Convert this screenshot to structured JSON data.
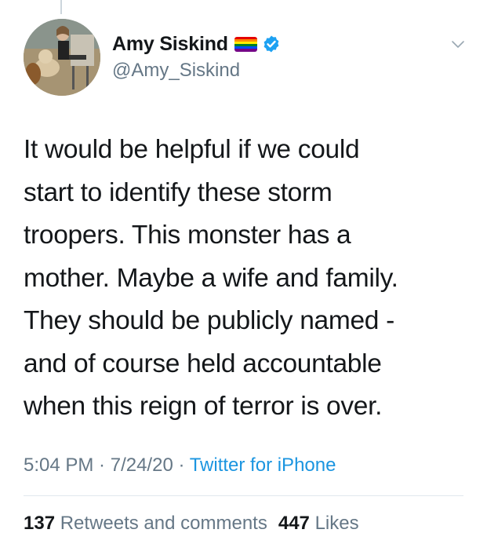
{
  "tweet": {
    "display_name": "Amy Siskind",
    "handle": "@Amy_Siskind",
    "text_lines": [
      "It would be helpful if we could",
      "start to identify these storm",
      "troopers.  This monster has a",
      "mother. Maybe a wife and family.",
      "They should be publicly named -",
      "and of course held accountable",
      "when this reign of terror is over."
    ],
    "time": "5:04 PM",
    "date": "7/24/20",
    "separator": " · ",
    "source": "Twitter for iPhone",
    "retweets_count": "137",
    "retweets_label": "Retweets and comments",
    "likes_count": "447",
    "likes_label": "Likes"
  },
  "icons": {
    "avatar": "profile-photo",
    "flag": "rainbow-flag-icon",
    "verified": "verified-badge-icon",
    "caret": "chevron-down-icon"
  },
  "colors": {
    "text": "#14171a",
    "secondary": "#657786",
    "link": "#1b95e0",
    "verified": "#1da1f2",
    "divider": "#e1e8ed"
  }
}
